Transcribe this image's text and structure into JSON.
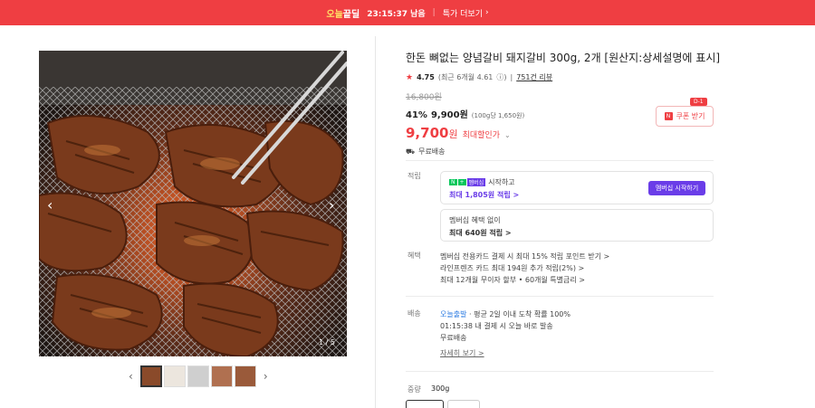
{
  "topbar": {
    "deal_prefix": "오늘",
    "deal_suffix": "끝딜",
    "timer": "23:15:37 남음",
    "more_label": "특가 더보기"
  },
  "gallery": {
    "counter": "1 / 5",
    "thumbnail_count": 5
  },
  "product": {
    "title": "한돈 뼈없는 양념갈비 돼지갈비 300g, 2개 [원산지:상세설명에 표시]",
    "rating": "4.75",
    "rating_detail": "(최근 6개월 4.61",
    "review_count": "751건 리뷰",
    "original_price": "16,800원",
    "discount_percent": "41%",
    "discount_price": "9,900원",
    "unit_price": "(100g당 1,650원)",
    "final_price": "9,700",
    "final_price_won": "원",
    "final_price_label": "최대할인가",
    "shipping": "무료배송"
  },
  "coupon": {
    "tag": "D-1",
    "label": "쿠폰 받기",
    "badge": "N"
  },
  "points": {
    "section_label": "적립",
    "npay_label": "N",
    "plus_label": "멤버십",
    "start_text": "시작하고",
    "max_points": "최대 1,805원 적립 >",
    "member_button": "멤버십 시작하기",
    "no_member_text": "멤버십 혜택 없이",
    "no_member_points": "최대 640원 적립 >"
  },
  "benefits": {
    "section_label": "혜택",
    "items": [
      "멤버십 전용카드 결제 시 최대 15% 적립 포인트 받기 >",
      "라인프렌즈 카드 최대 194원 추가 적립(2%) >",
      "최대 12개월 무이자 할부 • 60개월 특별금리 >"
    ]
  },
  "delivery": {
    "section_label": "배송",
    "fast_label": "오늘출발",
    "line1_rest": " · 평균 2일 이내 도착 확률 100%",
    "line2": "01:15:38  내 결제 시 오늘 바로 발송",
    "line3": "무료배송",
    "more_link": "자세히 보기 >"
  },
  "options": {
    "section_label": "중량",
    "selected": "300g"
  },
  "colors": {
    "brand_red": "#ef3e42",
    "membership_purple": "#6a3de8",
    "npay_green": "#03c75a"
  }
}
